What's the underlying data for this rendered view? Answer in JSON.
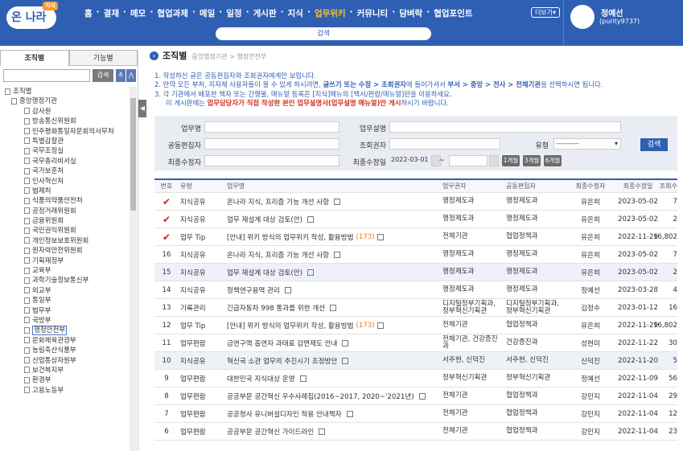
{
  "brand": {
    "logo": "온 나라",
    "badge": "지식"
  },
  "menu": [
    "홈",
    "결재",
    "메모",
    "협업과제",
    "메일",
    "일정",
    "게시판",
    "지식",
    "업무위키",
    "커뮤니티",
    "담벼락",
    "협업포인트"
  ],
  "menu_active_index": 8,
  "more_label": "더보기▾",
  "global_search_label": "검색",
  "profile": {
    "name": "정예선",
    "id": "(purity9737)"
  },
  "sidebar": {
    "tab_org": "조직별",
    "tab_func": "기능별",
    "search_btn": "검색",
    "tree": [
      "조직별",
      "중앙행정기관",
      "감사원",
      "방송통신위원회",
      "민주평화통일자문회의사무처",
      "특별감찰관",
      "국무조정실",
      "국무총리비서실",
      "국가보훈처",
      "인사혁신처",
      "법제처",
      "식품의약품안전처",
      "공정거래위원회",
      "금융위원회",
      "국민권익위원회",
      "개인정보보호위원회",
      "원자력안전위원회",
      "기획재정부",
      "교육부",
      "과학기술정보통신부",
      "외교부",
      "통일부",
      "법무부",
      "국방부",
      "행정안전부",
      "문화체육관광부",
      "농림축산식품부",
      "산업통상자원부",
      "보건복지부",
      "환경부",
      "고용노동부"
    ],
    "selected_index": 24
  },
  "page": {
    "title": "조직별",
    "crumb": "중앙행정기관  >  행정안전부"
  },
  "notice": {
    "line1": "1. 작성하신 글은 공동편집자와 조회권자에게만 보입니다.",
    "line2a": "2. 만약 모든 부처, 지자체 사용자들이 볼 수 있게 하시려면, ",
    "line2b": "글쓰기 또는 수정 > 조회권자",
    "line2c": "에 들어가셔서 ",
    "line2d": "부서 > 중앙 > 전사 > 전체기관",
    "line2e": "을 선택하시면 됩니다.",
    "line3": "3. 각 기관에서 배포한 책자 또는 간행물, 매뉴얼 등록은 [지식]메뉴의 [백서/편람/매뉴얼]란을 이용하세요.",
    "line4a": "이 게시판에는 ",
    "line4b": "업무담당자가 직접 작성한 본인 업무설명서(업무설명 매뉴얼)만 게시",
    "line4c": "하시기 바랍니다."
  },
  "form": {
    "subject_label": "업무명",
    "desc_label": "업무설명",
    "coeditor_label": "공동편집자",
    "viewer_label": "조회권자",
    "type_label": "유형",
    "type_value": "----------",
    "modifier_label": "최종수정자",
    "moddate_label": "최종수정일",
    "date_from": "2022-03-01",
    "tilde": "~",
    "btn_1m": "1개월",
    "btn_3m": "3개월",
    "btn_6m": "6개월",
    "search_btn": "검색"
  },
  "table": {
    "headers": [
      "번호",
      "유형",
      "업무명",
      "업무권자",
      "공동편집자",
      "최종수정자",
      "최종수정일",
      "조회수"
    ],
    "rows": [
      {
        "no": "✔",
        "type": "지식공유",
        "subject": "온나라 지식, 프리즘 기능 개선 사항",
        "count": "",
        "owner": "행정제도과",
        "editor": "행정제도과",
        "modifier": "유은희",
        "date": "2023-05-02",
        "views": "7"
      },
      {
        "no": "✔",
        "type": "지식공유",
        "subject": "업무 재설계 대상 검토(안)",
        "count": "",
        "owner": "행정제도과",
        "editor": "행정제도과",
        "modifier": "유은희",
        "date": "2023-05-02",
        "views": "2"
      },
      {
        "no": "✔",
        "type": "업무 Tip",
        "subject": "[안내] 위키 방식의 업무위키 작성, 활용방법",
        "count": "(173)",
        "owner": "전체기관",
        "editor": "협업정책과",
        "modifier": "유은희",
        "date": "2022-11-29",
        "views": "16,802"
      },
      {
        "no": "16",
        "type": "지식공유",
        "subject": "온나라 지식, 프리즘 기능 개선 사항",
        "count": "",
        "owner": "행정제도과",
        "editor": "행정제도과",
        "modifier": "유은희",
        "date": "2023-05-02",
        "views": "7"
      },
      {
        "no": "15",
        "type": "지식공유",
        "subject": "업무 재설계 대상 검토(안)",
        "count": "",
        "owner": "행정제도과",
        "editor": "행정제도과",
        "modifier": "유은희",
        "date": "2023-05-02",
        "views": "2"
      },
      {
        "no": "14",
        "type": "지식공유",
        "subject": "정책연구용역 관리",
        "count": "",
        "owner": "행정제도과",
        "editor": "행정제도과",
        "modifier": "정예선",
        "date": "2023-03-28",
        "views": "4"
      },
      {
        "no": "13",
        "type": "기록관리",
        "subject": "긴급자동차 998 통과를 위한 개선",
        "count": "",
        "owner": "디지털정부기획과, 정부혁신기획관",
        "editor": "디지털정부기획과, 정부혁신기획관",
        "modifier": "김정수",
        "date": "2023-01-12",
        "views": "16"
      },
      {
        "no": "12",
        "type": "업무 Tip",
        "subject": "[안내] 위키 방식의 업무위키 작성, 활용방법",
        "count": "(173)",
        "owner": "전체기관",
        "editor": "협업정책과",
        "modifier": "유은희",
        "date": "2022-11-29",
        "views": "16,802"
      },
      {
        "no": "11",
        "type": "업무편람",
        "subject": "금연구역 흡연자 과태료 감면제도 안내",
        "count": "",
        "owner": "전체기관, 건강증진과",
        "editor": "건강증진과",
        "modifier": "성현미",
        "date": "2022-11-22",
        "views": "30"
      },
      {
        "no": "10",
        "type": "지식공유",
        "subject": "혁신국 소관 업무의 추진시기 조정방안",
        "count": "",
        "owner": "서주현, 신덕진",
        "editor": "서주현, 신덕진",
        "modifier": "신덕진",
        "date": "2022-11-20",
        "views": "5"
      },
      {
        "no": "9",
        "type": "업무편람",
        "subject": "대한민국 지식대상 운영",
        "count": "",
        "owner": "정부혁신기획관",
        "editor": "정부혁신기획관",
        "modifier": "정예선",
        "date": "2022-11-09",
        "views": "56"
      },
      {
        "no": "8",
        "type": "업무편람",
        "subject": "공공부문 공간혁신 우수사례집(2016~2017, 2020~'2021년)",
        "count": "",
        "owner": "전체기관",
        "editor": "협업정책과",
        "modifier": "강민지",
        "date": "2022-11-04",
        "views": "29"
      },
      {
        "no": "7",
        "type": "업무편람",
        "subject": "공공청사 유니버설디자인 적용 안내책자",
        "count": "",
        "owner": "전체기관",
        "editor": "협업정책과",
        "modifier": "강민지",
        "date": "2022-11-04",
        "views": "12"
      },
      {
        "no": "6",
        "type": "업무편람",
        "subject": "공공부문 공간혁신 가이드라인",
        "count": "",
        "owner": "전체기관",
        "editor": "협업정책과",
        "modifier": "강민지",
        "date": "2022-11-04",
        "views": "23"
      }
    ]
  }
}
